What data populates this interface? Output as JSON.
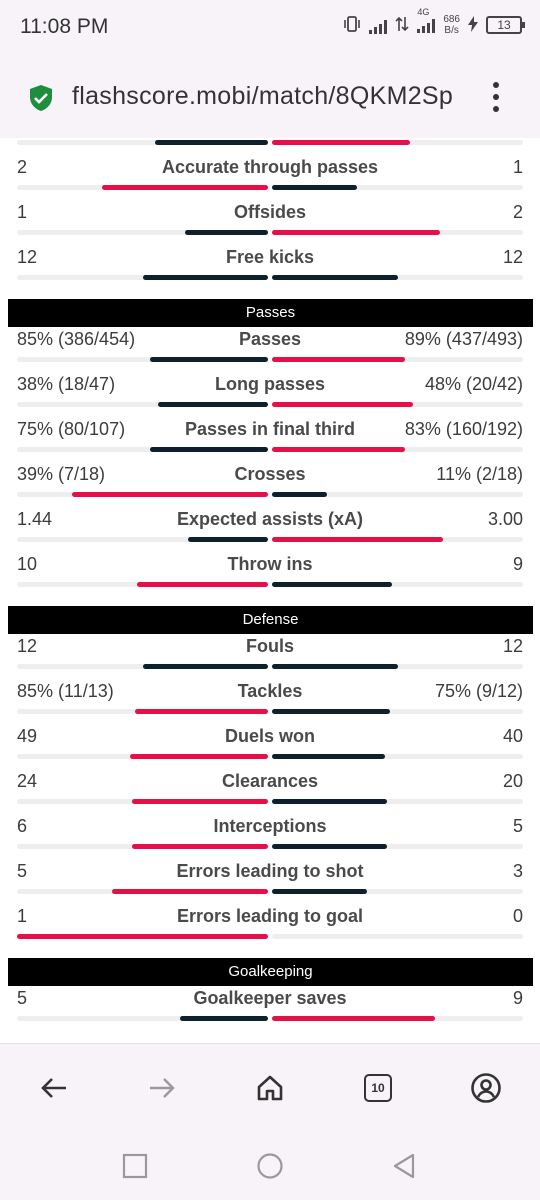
{
  "status": {
    "time": "11:08 PM",
    "network": "4G",
    "speed_value": "686",
    "speed_unit": "B/s",
    "battery": "13"
  },
  "browser": {
    "url": "flashscore.mobi/match/8QKM2Sp",
    "tab_count": "10"
  },
  "colors": {
    "home_dark": "#0d202b",
    "away_red": "#e60f47",
    "section_bg": "#000000"
  },
  "rows": [
    {
      "label": "",
      "home": "",
      "away": "",
      "home_pct": 45,
      "away_pct": 55,
      "home_color": "dark",
      "away_color": "red"
    },
    {
      "label": "Accurate through passes",
      "home": "2",
      "away": "1",
      "home_pct": 66,
      "away_pct": 34,
      "home_color": "red",
      "away_color": "dark"
    },
    {
      "label": "Offsides",
      "home": "1",
      "away": "2",
      "home_pct": 33,
      "away_pct": 67,
      "home_color": "dark",
      "away_color": "red"
    },
    {
      "label": "Free kicks",
      "home": "12",
      "away": "12",
      "home_pct": 50,
      "away_pct": 50,
      "home_color": "dark",
      "away_color": "dark"
    },
    {
      "section": "Passes"
    },
    {
      "label": "Passes",
      "home": "85% (386/454)",
      "away": "89% (437/493)",
      "home_pct": 47,
      "away_pct": 53,
      "home_color": "dark",
      "away_color": "red"
    },
    {
      "label": "Long passes",
      "home": "38% (18/47)",
      "away": "48% (20/42)",
      "home_pct": 44,
      "away_pct": 56,
      "home_color": "dark",
      "away_color": "red"
    },
    {
      "label": "Passes in final third",
      "home": "75% (80/107)",
      "away": "83% (160/192)",
      "home_pct": 47,
      "away_pct": 53,
      "home_color": "dark",
      "away_color": "red"
    },
    {
      "label": "Crosses",
      "home": "39% (7/18)",
      "away": "11% (2/18)",
      "home_pct": 78,
      "away_pct": 22,
      "home_color": "red",
      "away_color": "dark"
    },
    {
      "label": "Expected assists (xA)",
      "home": "1.44",
      "away": "3.00",
      "home_pct": 32,
      "away_pct": 68,
      "home_color": "dark",
      "away_color": "red"
    },
    {
      "label": "Throw ins",
      "home": "10",
      "away": "9",
      "home_pct": 52,
      "away_pct": 48,
      "home_color": "red",
      "away_color": "dark"
    },
    {
      "section": "Defense"
    },
    {
      "label": "Fouls",
      "home": "12",
      "away": "12",
      "home_pct": 50,
      "away_pct": 50,
      "home_color": "dark",
      "away_color": "dark"
    },
    {
      "label": "Tackles",
      "home": "85% (11/13)",
      "away": "75% (9/12)",
      "home_pct": 53,
      "away_pct": 47,
      "home_color": "red",
      "away_color": "dark"
    },
    {
      "label": "Duels won",
      "home": "49",
      "away": "40",
      "home_pct": 55,
      "away_pct": 45,
      "home_color": "red",
      "away_color": "dark"
    },
    {
      "label": "Clearances",
      "home": "24",
      "away": "20",
      "home_pct": 54,
      "away_pct": 46,
      "home_color": "red",
      "away_color": "dark"
    },
    {
      "label": "Interceptions",
      "home": "6",
      "away": "5",
      "home_pct": 54,
      "away_pct": 46,
      "home_color": "red",
      "away_color": "dark"
    },
    {
      "label": "Errors leading to shot",
      "home": "5",
      "away": "3",
      "home_pct": 62,
      "away_pct": 38,
      "home_color": "red",
      "away_color": "dark"
    },
    {
      "label": "Errors leading to goal",
      "home": "1",
      "away": "0",
      "home_pct": 100,
      "away_pct": 0,
      "home_color": "red",
      "away_color": "dark"
    },
    {
      "section": "Goalkeeping"
    },
    {
      "label": "Goalkeeper saves",
      "home": "5",
      "away": "9",
      "home_pct": 35,
      "away_pct": 65,
      "home_color": "dark",
      "away_color": "red"
    }
  ],
  "icons": {
    "back": "back-arrow-icon",
    "forward": "forward-arrow-icon",
    "home": "home-icon",
    "tabs": "tabs-icon",
    "account": "account-icon",
    "recents": "recents-square-icon",
    "home_sys": "home-circle-icon",
    "back_sys": "back-triangle-icon"
  }
}
